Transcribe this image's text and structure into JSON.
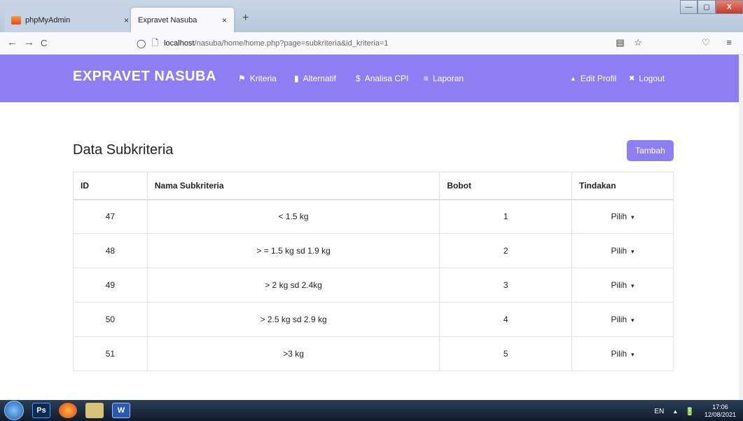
{
  "browser": {
    "tabs": [
      {
        "label": "phpMyAdmin",
        "close": "×"
      },
      {
        "label": "Expravet Nasuba",
        "close": "×"
      }
    ],
    "new_tab": "+",
    "window_controls": {
      "minimize": "—",
      "maximize": "▢",
      "close": "X"
    },
    "nav": {
      "back": "←",
      "forward": "→",
      "reload": "C"
    },
    "url_host": "localhost",
    "url_path": "/nasuba/home/home.php?page=subkriteria&id_kriteria=1",
    "url_icons": {
      "shield": "◯",
      "page": "🗋",
      "reader": "▤",
      "star": "☆"
    },
    "right_buttons": {
      "pocket": "♡",
      "menu": "≡"
    }
  },
  "app": {
    "brand": "EXPRAVET NASUBA",
    "menu": [
      {
        "icon": "⚑",
        "label": "Kriteria"
      },
      {
        "icon": "▮",
        "label": "Alternatif"
      },
      {
        "icon": "$",
        "label": "Analisa CPI"
      },
      {
        "icon": "≡",
        "label": "Laporan"
      }
    ],
    "menu_right": [
      {
        "icon": "▲",
        "label": "Edit Profil"
      },
      {
        "icon": "✖",
        "label": "Logout"
      }
    ],
    "accent_color": "#8e7ef4"
  },
  "page": {
    "title": "Data Subkriteria",
    "add_button": "Tambah",
    "table": {
      "headers": [
        "ID",
        "Nama Subkriteria",
        "Bobot",
        "Tindakan"
      ],
      "rows": [
        {
          "id": "47",
          "nama": "< 1.5 kg",
          "bobot": "1",
          "aksi": "Pilih"
        },
        {
          "id": "48",
          "nama": "> = 1.5 kg sd 1.9 kg",
          "bobot": "2",
          "aksi": "Pilih"
        },
        {
          "id": "49",
          "nama": "> 2 kg sd 2.4kg",
          "bobot": "3",
          "aksi": "Pilih"
        },
        {
          "id": "50",
          "nama": "> 2.5 kg sd 2.9 kg",
          "bobot": "4",
          "aksi": "Pilih"
        },
        {
          "id": "51",
          "nama": ">3 kg",
          "bobot": "5",
          "aksi": "Pilih"
        }
      ],
      "caret": "▾"
    }
  },
  "taskbar": {
    "apps": [
      {
        "name": "Ps",
        "color": "#0a2a55"
      },
      {
        "name": "",
        "color": "#e2641d"
      },
      {
        "name": "",
        "color": "#c8a640"
      },
      {
        "name": "W",
        "color": "#2a5ab0"
      }
    ],
    "lang": "EN",
    "tray_arrow": "▲",
    "tray_icon": "🔋",
    "time": "17:06",
    "date": "12/08/2021"
  }
}
